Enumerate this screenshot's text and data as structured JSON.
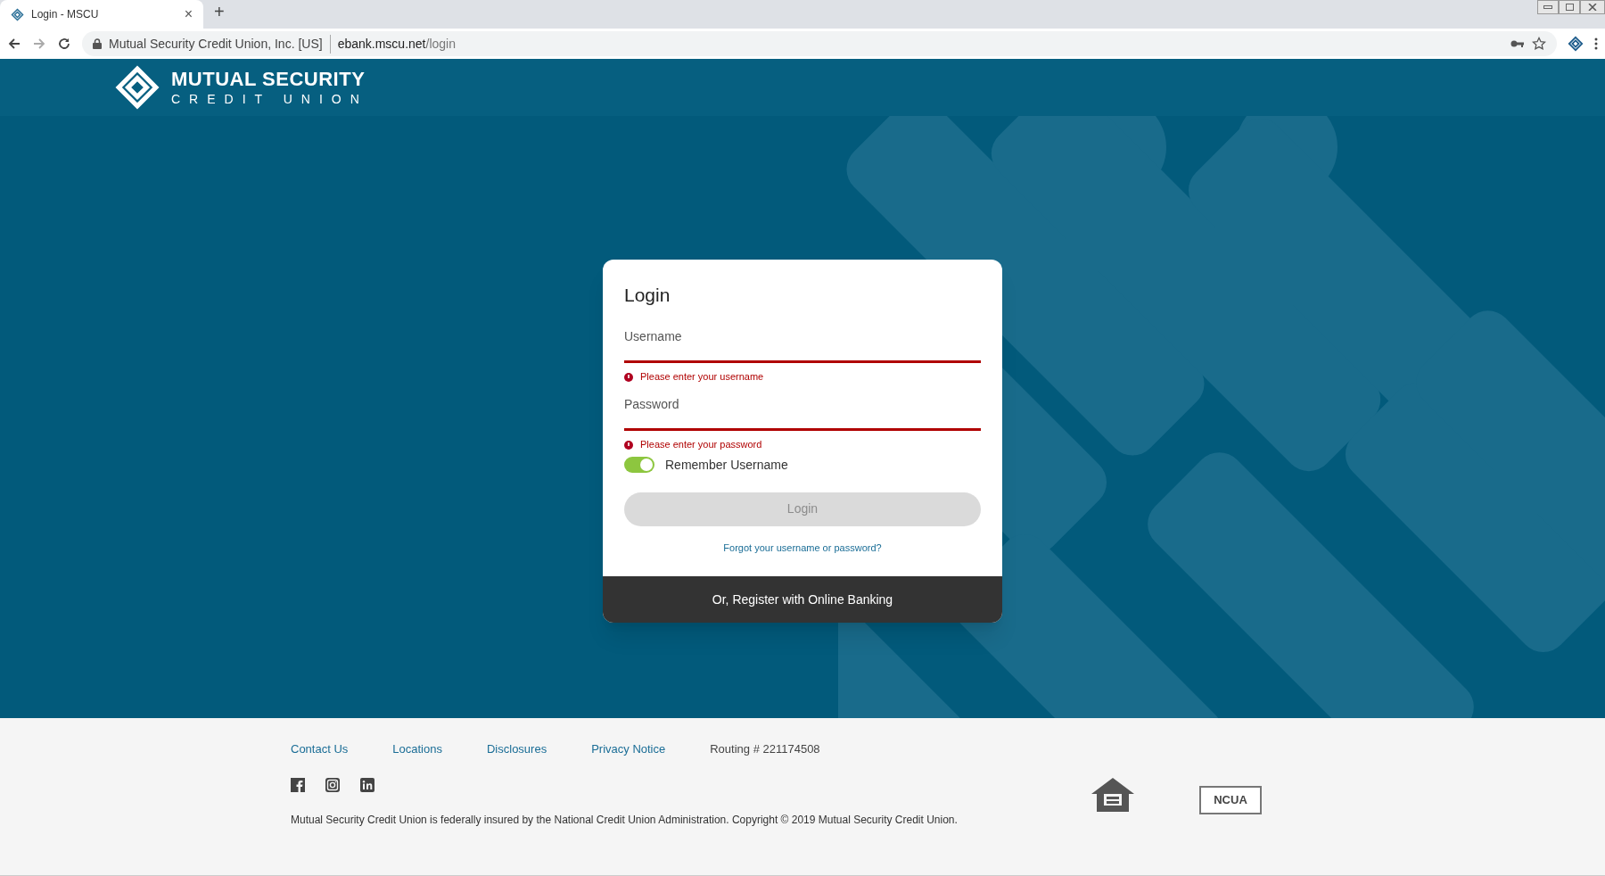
{
  "browser": {
    "tab_title": "Login - MSCU",
    "close": "×",
    "new_tab": "+",
    "site_identity": "Mutual Security Credit Union, Inc. [US]",
    "url_domain": "ebank.mscu.net",
    "url_path": "/login"
  },
  "header": {
    "logo_line1": "MUTUAL SECURITY",
    "logo_line2": "CREDIT UNION"
  },
  "login": {
    "title": "Login",
    "fields": [
      {
        "label": "Username",
        "error": "Please enter your username"
      },
      {
        "label": "Password",
        "error": "Please enter your password"
      }
    ],
    "remember": {
      "label": "Remember Username",
      "on": true
    },
    "button": {
      "label": "Login",
      "disabled": true
    },
    "forgot_link": "Forgot your username or password?",
    "register": "Or, Register with Online Banking"
  },
  "footer": {
    "links": [
      "Contact Us",
      "Locations",
      "Disclosures",
      "Privacy Notice"
    ],
    "routing": "Routing # 221174508",
    "social": [
      {
        "kind": "facebook"
      },
      {
        "kind": "instagram"
      },
      {
        "kind": "linkedin"
      }
    ],
    "copyright": "Mutual Security Credit Union is federally insured by the National Credit Union Administration. Copyright © 2019 Mutual Security Credit Union.",
    "ncua": "NCUA"
  }
}
